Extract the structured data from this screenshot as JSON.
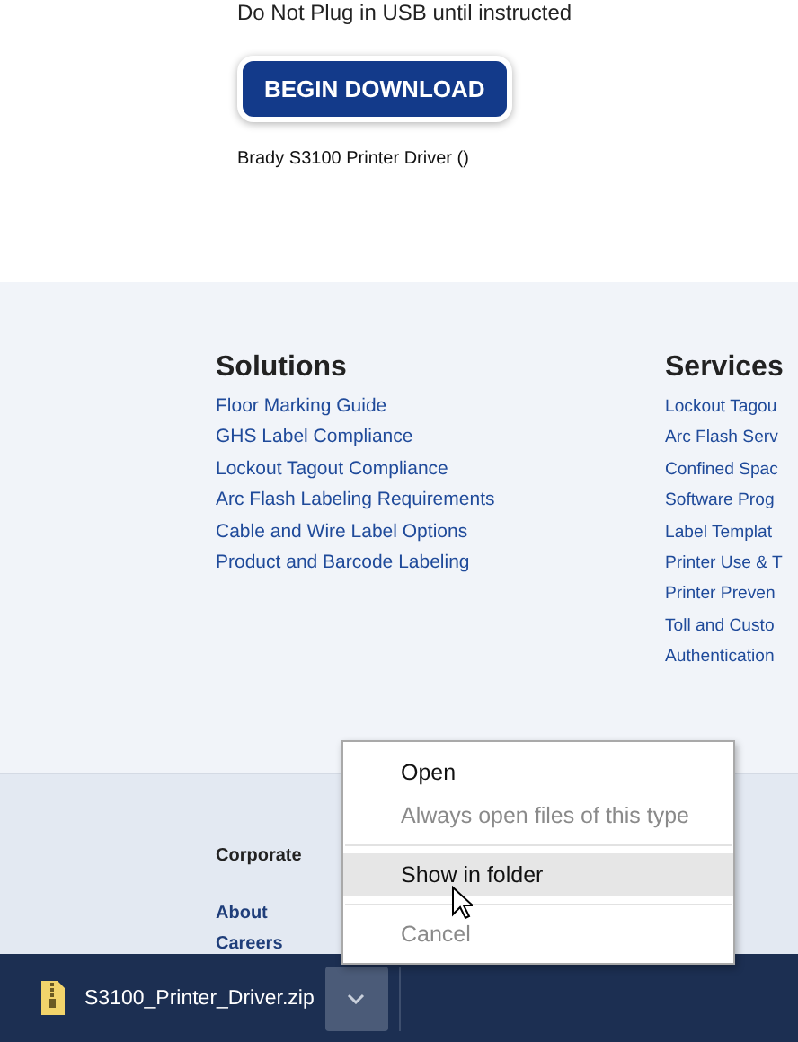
{
  "notice": "Do Not Plug in USB until instructed",
  "download_button": "BEGIN DOWNLOAD",
  "driver_name": "Brady S3100 Printer Driver ()",
  "footer_columns": [
    {
      "title": "Solutions",
      "links": [
        "Floor Marking Guide",
        "GHS Label Compliance",
        "Lockout Tagout Compliance",
        "Arc Flash Labeling Requirements",
        "Cable and Wire Label Options",
        "Product and Barcode Labeling"
      ]
    },
    {
      "title": "Services",
      "links": [
        "Lockout Tagou",
        "Arc Flash Serv",
        "Confined Spac",
        "Software Prog",
        "Label Templat",
        "Printer Use & T",
        "Printer Preven",
        "Toll and Custo",
        "Authentication"
      ]
    }
  ],
  "corporate": {
    "title": "Corporate",
    "links": [
      "About",
      "Careers"
    ]
  },
  "download_bar": {
    "file_name": "S3100_Printer_Driver.zip",
    "menu_open": true
  },
  "context_menu": [
    {
      "kind": "item",
      "label": "Open",
      "disabled": false,
      "selected": false
    },
    {
      "kind": "item",
      "label": "Always open files of this type",
      "disabled": true,
      "selected": false
    },
    {
      "kind": "separator"
    },
    {
      "kind": "item",
      "label": "Show in folder",
      "disabled": false,
      "selected": true
    },
    {
      "kind": "separator"
    },
    {
      "kind": "item",
      "label": "Cancel",
      "disabled": true,
      "selected": false
    }
  ]
}
